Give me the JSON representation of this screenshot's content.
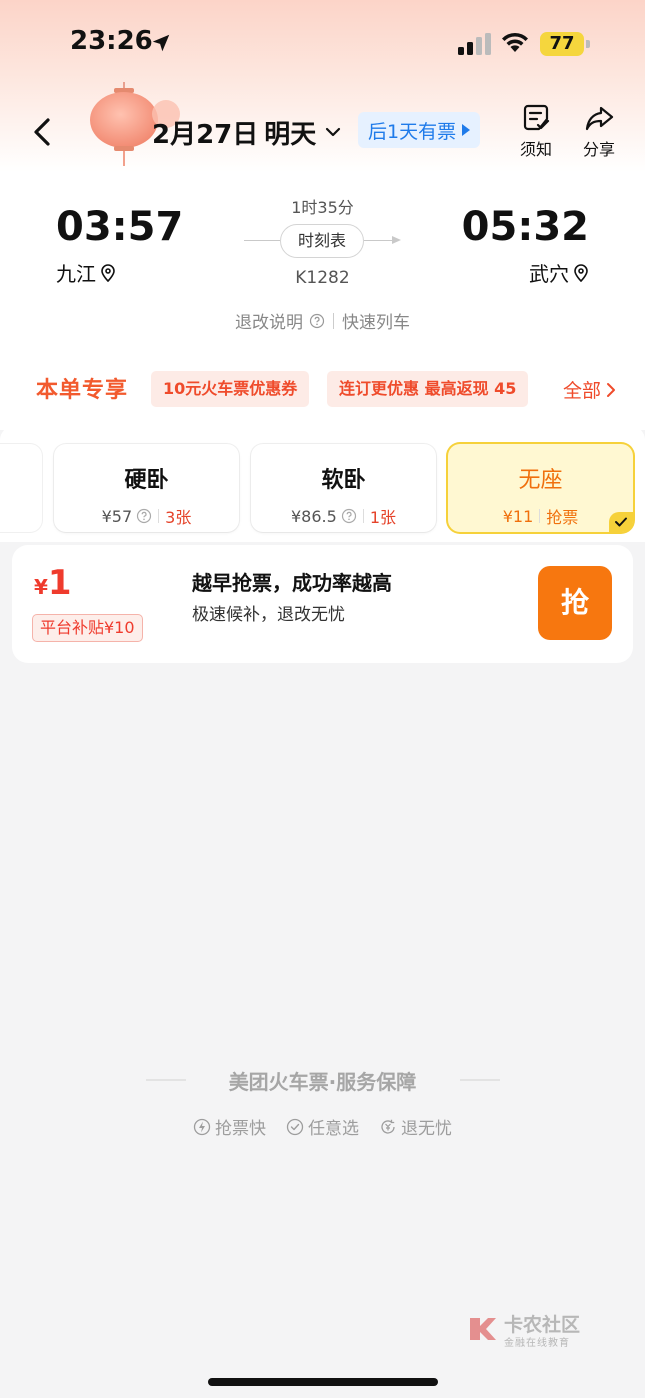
{
  "status_bar": {
    "time": "23:26",
    "battery": "77"
  },
  "nav": {
    "date": "2月27日",
    "day": "明天",
    "next_ticket": "后1天有票",
    "notice_label": "须知",
    "share_label": "分享"
  },
  "journey": {
    "depart_time": "03:57",
    "depart_station": "九江",
    "arrive_time": "05:32",
    "arrive_station": "武穴",
    "duration": "1时35分",
    "schedule_label": "时刻表",
    "train_no": "K1282",
    "refund_label": "退改说明",
    "train_type": "快速列车"
  },
  "promo": {
    "title": "本单专享",
    "coupons": [
      "10元火车票优惠券",
      "连订更优惠 最高返现 45"
    ],
    "all_label": "全部"
  },
  "seats": [
    {
      "name": "硬卧",
      "price": "¥57",
      "availability": "3张",
      "selected": false
    },
    {
      "name": "软卧",
      "price": "¥86.5",
      "availability": "1张",
      "selected": false
    },
    {
      "name": "无座",
      "price": "¥11",
      "availability": "抢票",
      "selected": true
    }
  ],
  "grab": {
    "currency": "¥",
    "price": "1",
    "subsidy": "平台补贴¥10",
    "title": "越早抢票，成功率越高",
    "desc": "极速候补，退改无忧",
    "button": "抢"
  },
  "guarantee": {
    "title": "美团火车票·服务保障",
    "items": [
      "抢票快",
      "任意选",
      "退无忧"
    ]
  },
  "watermark": {
    "main": "卡农社区",
    "sub": "金融在线教育"
  },
  "colors": {
    "accent_orange": "#f7770f",
    "promo_red": "#ef4b2b",
    "link_blue": "#1f7bea",
    "selected_yellow": "#f6d13a"
  }
}
